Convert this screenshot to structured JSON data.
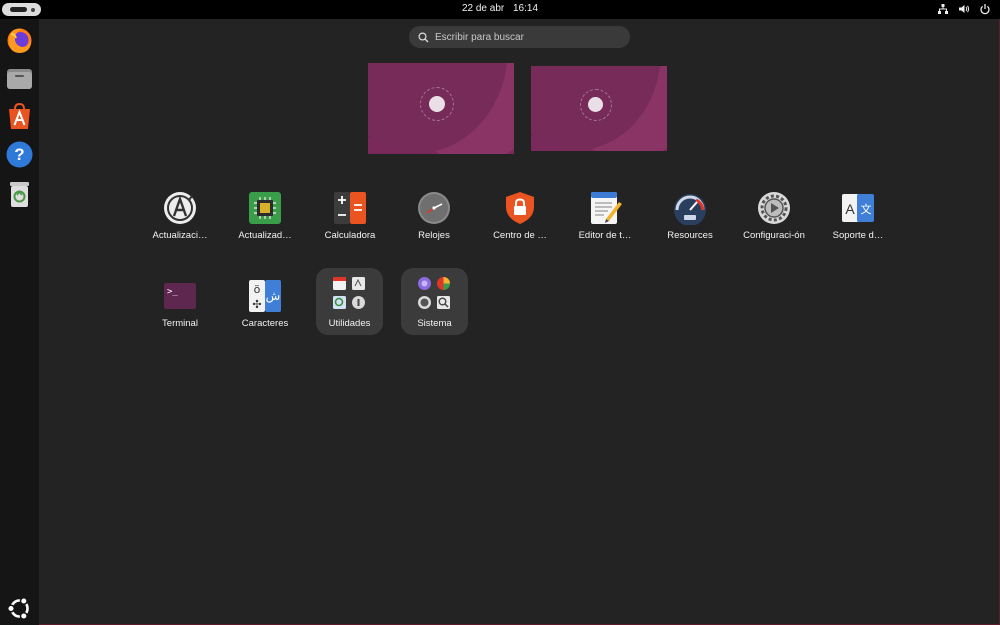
{
  "topbar": {
    "date": "22 de abr",
    "time": "16:14",
    "tray_icons": [
      "network-icon",
      "volume-icon",
      "power-icon"
    ]
  },
  "dock": {
    "items": [
      {
        "name": "firefox",
        "icon": "firefox-icon"
      },
      {
        "name": "files",
        "icon": "files-icon"
      },
      {
        "name": "app-center",
        "icon": "app-center-icon"
      },
      {
        "name": "help",
        "icon": "help-icon"
      },
      {
        "name": "trash",
        "icon": "trash-icon"
      }
    ],
    "show_apps_icon": "ubuntu-logo-icon"
  },
  "search": {
    "placeholder": "Escribir para buscar"
  },
  "workspaces": 2,
  "apps": [
    {
      "label": "Actualizaci…",
      "icon": "software-updater-icon"
    },
    {
      "label": "Actualizad…",
      "icon": "firmware-updater-icon"
    },
    {
      "label": "Calculadora",
      "icon": "calculator-icon"
    },
    {
      "label": "Relojes",
      "icon": "clocks-icon"
    },
    {
      "label": "Centro de …",
      "icon": "security-center-icon"
    },
    {
      "label": "Editor de t…",
      "icon": "text-editor-icon"
    },
    {
      "label": "Resources",
      "icon": "resources-icon"
    },
    {
      "label": "Configuraci-ón",
      "icon": "settings-icon"
    },
    {
      "label": "Soporte d…",
      "icon": "language-support-icon"
    },
    {
      "label": "Terminal",
      "icon": "terminal-icon"
    },
    {
      "label": "Caracteres",
      "icon": "characters-icon"
    },
    {
      "label": "Utilidades",
      "icon": "utilities-folder-icon",
      "folder": true
    },
    {
      "label": "Sistema",
      "icon": "system-folder-icon",
      "folder": true
    }
  ],
  "colors": {
    "accent": "#e95420",
    "wallpaper": "#7a2a5a",
    "panel": "#000000"
  }
}
